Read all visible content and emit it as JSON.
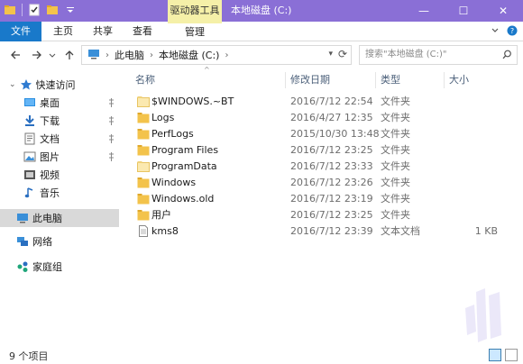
{
  "titlebar": {
    "context_group": "驱动器工具",
    "window_title": "本地磁盘 (C:)",
    "controls": {
      "minimize": "—",
      "maximize": "☐",
      "close": "✕"
    }
  },
  "ribbon": {
    "tabs": [
      {
        "label": "文件"
      },
      {
        "label": "主页"
      },
      {
        "label": "共享"
      },
      {
        "label": "查看"
      },
      {
        "label": "管理"
      }
    ]
  },
  "address": {
    "breadcrumbs": [
      "此电脑",
      "本地磁盘 (C:)"
    ],
    "search_placeholder": "搜索\"本地磁盘 (C:)\""
  },
  "nav_pane": {
    "quick_access": "快速访问",
    "items": [
      {
        "label": "桌面",
        "icon": "desktop-icon",
        "pinned": true
      },
      {
        "label": "下载",
        "icon": "download-icon",
        "pinned": true
      },
      {
        "label": "文档",
        "icon": "document-icon",
        "pinned": true
      },
      {
        "label": "图片",
        "icon": "picture-icon",
        "pinned": true
      },
      {
        "label": "视频",
        "icon": "video-icon",
        "pinned": false
      },
      {
        "label": "音乐",
        "icon": "music-icon",
        "pinned": false
      }
    ],
    "this_pc": "此电脑",
    "network": "网络",
    "homegroup": "家庭组"
  },
  "columns": {
    "name": "名称",
    "date": "修改日期",
    "type": "类型",
    "size": "大小"
  },
  "files": [
    {
      "name": "$WINDOWS.~BT",
      "date": "2016/7/12 22:54",
      "type": "文件夹",
      "size": "",
      "kind": "folder"
    },
    {
      "name": "Logs",
      "date": "2016/4/27 12:35",
      "type": "文件夹",
      "size": "",
      "kind": "folder"
    },
    {
      "name": "PerfLogs",
      "date": "2015/10/30 13:48",
      "type": "文件夹",
      "size": "",
      "kind": "folder"
    },
    {
      "name": "Program Files",
      "date": "2016/7/12 23:25",
      "type": "文件夹",
      "size": "",
      "kind": "folder"
    },
    {
      "name": "ProgramData",
      "date": "2016/7/12 23:33",
      "type": "文件夹",
      "size": "",
      "kind": "folder"
    },
    {
      "name": "Windows",
      "date": "2016/7/12 23:26",
      "type": "文件夹",
      "size": "",
      "kind": "folder"
    },
    {
      "name": "Windows.old",
      "date": "2016/7/12 23:19",
      "type": "文件夹",
      "size": "",
      "kind": "folder"
    },
    {
      "name": "用户",
      "date": "2016/7/12 23:25",
      "type": "文件夹",
      "size": "",
      "kind": "folder"
    },
    {
      "name": "kms8",
      "date": "2016/7/12 23:39",
      "type": "文本文档",
      "size": "1 KB",
      "kind": "text"
    }
  ],
  "status": {
    "item_count": "9 个项目"
  },
  "colors": {
    "titlebar": "#8a6fd6",
    "file_tab": "#1979ca",
    "context_highlight": "#f5f0a8",
    "folder": "#f3c34b",
    "selection": "#d9d9d9"
  }
}
